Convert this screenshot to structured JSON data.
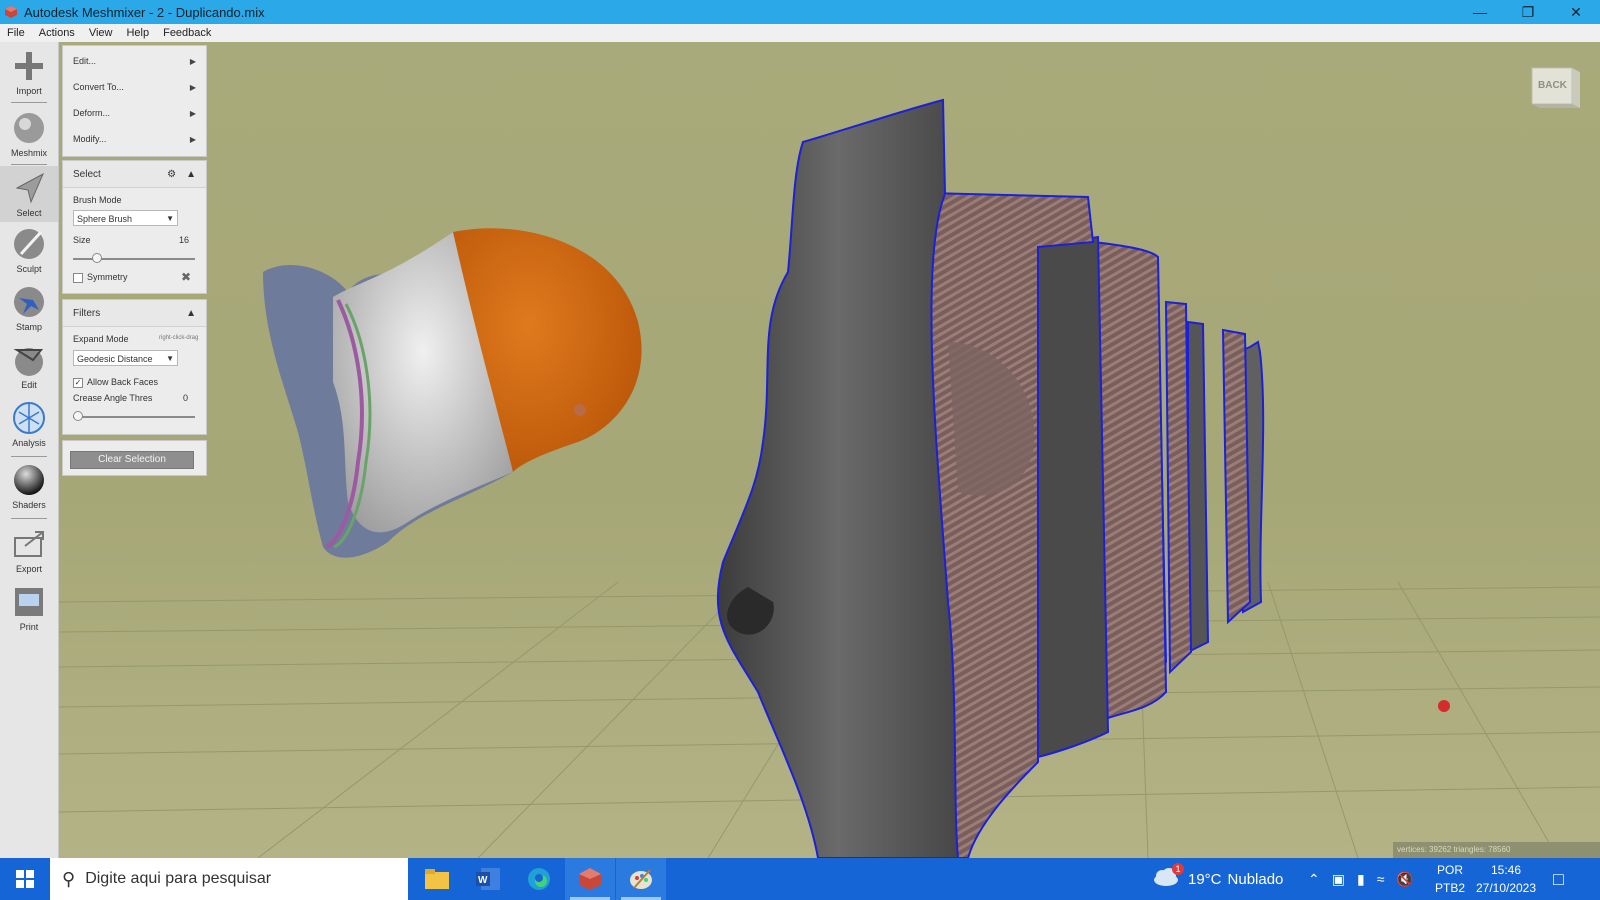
{
  "window": {
    "title": "Autodesk Meshmixer - 2 - Duplicando.mix"
  },
  "menubar": {
    "items": [
      "File",
      "Actions",
      "View",
      "Help",
      "Feedback"
    ]
  },
  "toolbar": {
    "tools": [
      {
        "label": "Import",
        "icon": "import-icon"
      },
      {
        "label": "Meshmix",
        "icon": "meshmix-icon"
      },
      {
        "label": "Select",
        "icon": "select-icon",
        "active": true
      },
      {
        "label": "Sculpt",
        "icon": "sculpt-icon"
      },
      {
        "label": "Stamp",
        "icon": "stamp-icon"
      },
      {
        "label": "Edit",
        "icon": "edit-icon"
      },
      {
        "label": "Analysis",
        "icon": "analysis-icon"
      },
      {
        "label": "Shaders",
        "icon": "shaders-icon"
      },
      {
        "label": "Export",
        "icon": "export-icon"
      },
      {
        "label": "Print",
        "icon": "print-icon"
      }
    ]
  },
  "select_menu": {
    "items": [
      "Edit...",
      "Convert To...",
      "Deform...",
      "Modify..."
    ]
  },
  "select_panel": {
    "title": "Select",
    "brush_mode_label": "Brush Mode",
    "brush_mode_value": "Sphere Brush",
    "size_label": "Size",
    "size_value": "16",
    "size_fraction": 0.17,
    "symmetry_label": "Symmetry",
    "symmetry_checked": false
  },
  "filters_panel": {
    "title": "Filters",
    "expand_mode_label": "Expand Mode",
    "expand_mode_hint": "right-click-drag",
    "expand_mode_value": "Geodesic Distance",
    "allow_back_faces_label": "Allow Back Faces",
    "allow_back_faces_checked": true,
    "crease_label": "Crease Angle Thres",
    "crease_value": "0",
    "crease_fraction": 0.0
  },
  "clear_selection_label": "Clear Selection",
  "viewcube": {
    "label": "BACK"
  },
  "status_text": "vertices: 39262 triangles: 78560",
  "taskbar": {
    "search_placeholder": "Digite aqui para pesquisar",
    "apps": [
      "file-explorer-icon",
      "word-icon",
      "edge-icon",
      "meshmixer-icon",
      "paint-icon"
    ],
    "weather_badge": "1",
    "temperature": "19°C",
    "weather": "Nublado",
    "language": "POR",
    "layout": "PTB2",
    "time": "15:46",
    "date": "27/10/2023"
  },
  "colors": {
    "title_bar": "#2aa8e8",
    "viewport": "#a8a97a",
    "taskbar": "#1565d6",
    "selection": "#d96a12"
  }
}
